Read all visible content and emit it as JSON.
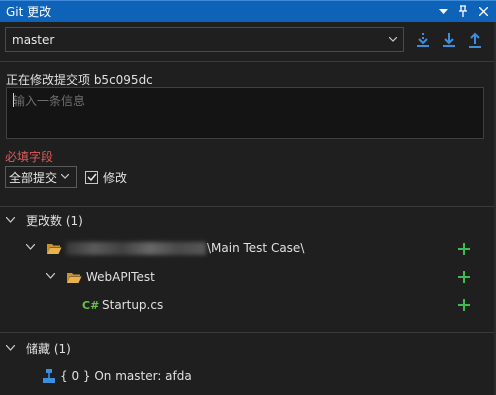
{
  "titlebar": {
    "title": "Git 更改",
    "icons": [
      "dropdown-icon",
      "pin-icon",
      "close-icon"
    ]
  },
  "branch": {
    "selected": "master",
    "actions": [
      "fetch-icon",
      "pull-icon",
      "push-icon"
    ]
  },
  "amend": {
    "label": "正在修改提交项 b5c095dc",
    "message_placeholder": "输入一条信息",
    "required_label": "必填字段"
  },
  "commit": {
    "button_label": "全部提交",
    "amend_checkbox_label": "修改",
    "amend_checked": true
  },
  "changes": {
    "header": "更改数 (1)",
    "root_folder_suffix": "\\Main Test Case\\",
    "subfolder": "WebAPITest",
    "file": "Startup.cs",
    "file_badge": "C#"
  },
  "stashes": {
    "header": "储藏 (1)",
    "item": "{ 0 } On master: afda"
  },
  "colors": {
    "accent": "#0e63b8",
    "add_green": "#3fb950",
    "folder": "#e8b34b",
    "required_red": "#e05a5a",
    "sync_blue": "#3c8fe0"
  }
}
